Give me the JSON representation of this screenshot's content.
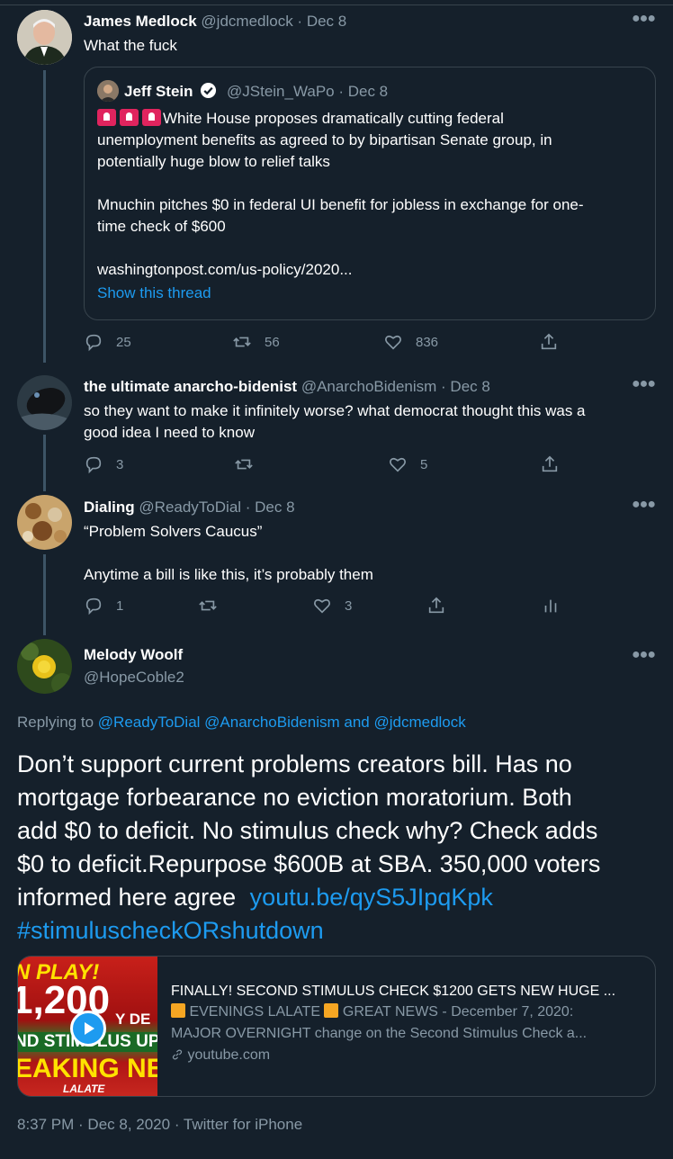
{
  "tweets": [
    {
      "name": "James Medlock",
      "handle": "@jdcmedlock · Dec 8",
      "text": "What the fuck",
      "quote": {
        "name": "Jeff Stein",
        "handle": "@JStein_WaPo · Dec 8",
        "line1": "White House proposes dramatically cutting federal",
        "line2": "unemployment benefits as agreed to by bipartisan Senate group, in",
        "line3": "potentially huge blow to relief talks",
        "line4": "Mnuchin pitches $0 in federal UI benefit for jobless in exchange for one-",
        "line5": "time check of $600",
        "line6": "washingtonpost.com/us-policy/2020...",
        "show_thread": "Show this thread"
      },
      "replies": "25",
      "retweets": "56",
      "likes": "836"
    },
    {
      "name": "the ultimate anarcho-bidenist",
      "handle": "@AnarchoBidenism · Dec 8",
      "line1": "so they want to make it infinitely worse? what democrat thought this was a",
      "line2": "good idea I need to know",
      "replies": "3",
      "likes": "5"
    },
    {
      "name": "Dialing",
      "handle": "@ReadyToDial · Dec 8",
      "line1": "“Problem Solvers Caucus”",
      "line2": "Anytime a bill is like this, it’s probably them",
      "replies": "1",
      "likes": "3"
    }
  ],
  "main": {
    "name": "Melody Woolf",
    "handle": "@HopeCoble2",
    "replying_label": "Replying to",
    "replying_to": "@ReadyToDial @AnarchoBidenism and @jdcmedlock",
    "body1": "Don’t support current problems creators bill. Has no",
    "body2": "mortgage forbearance no eviction moratorium. Both",
    "body3": "add $0 to deficit. No stimulus check why? Check adds",
    "body4": "$0 to deficit.Repurpose $600B at SBA. 350,000 voters",
    "body5": "informed here agree",
    "link": "youtu.be/qyS5JIpqKpk",
    "hashtag": "#stimuluscheckORshutdown",
    "card": {
      "title": "FINALLY! SECOND STIMULUS CHECK $1200 GETS NEW HUGE ...",
      "desc1": "EVENINGS LALATE",
      "desc2": "GREAT NEWS - December 7, 2020:",
      "desc3": "MAJOR OVERNIGHT change on the Second Stimulus Check a...",
      "domain": "youtube.com",
      "thumb_text1": "N PLAY!",
      "thumb_text2": "1,200",
      "thumb_text3": "Y DE",
      "thumb_text4": "ND STIMULUS UP",
      "thumb_text5": "EAKING NE",
      "thumb_text6": "LALATE"
    },
    "timestamp": "8:37 PM · Dec 8, 2020 · Twitter for iPhone"
  },
  "colors": {
    "background": "#15202b",
    "accent": "#1d9bf0",
    "muted": "#8899a6",
    "border": "#38444d"
  }
}
